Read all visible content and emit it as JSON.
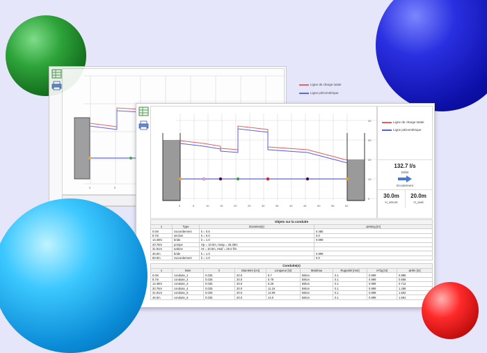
{
  "front": {
    "legend": [
      {
        "label": "Ligne de charge totale",
        "color": "#e85a5a"
      },
      {
        "label": "Ligne piézométrique",
        "color": "#5a5ae8"
      }
    ],
    "y_ticks": [
      "40",
      "30",
      "20",
      "10",
      "0"
    ],
    "x_ticks": [
      "0",
      "5",
      "10",
      "15",
      "20",
      "25",
      "30",
      "35",
      "40",
      "45",
      "50",
      "55",
      "60"
    ],
    "stats": {
      "flow_value": "132.7 l/s",
      "flow_label": "Débit",
      "flow_direction_label": "Ecoulement",
      "h_amont_value": "30.0m",
      "h_amont_label": "H_amont",
      "h_aval_value": "20.0m",
      "h_aval_label": "H_aval"
    },
    "objects_table": {
      "title": "Objets sur la conduite",
      "headers": [
        "x",
        "Type",
        "Données(s)",
        "ΔHsing [m]"
      ],
      "rows": [
        [
          "0.0m",
          "raccordement",
          "k = 0.5",
          "0.485"
        ],
        [
          "8.7m",
          "section",
          "k = 0.0",
          "0.0"
        ],
        [
          "14.49m",
          "bride",
          "k = 1.0",
          "0.999"
        ],
        [
          "20.75m",
          "pompe",
          "Hp = 10.0m, Hasp = 25.28m",
          ""
        ],
        [
          "31.91m",
          "turbine",
          "Ht = 10.0m, Hsaf = 25.0 f/m",
          ""
        ],
        [
          "46.0m",
          "bride",
          "k = 1.0",
          "0.999"
        ],
        [
          "60.0m",
          "raccordement",
          "k = 1.0",
          "0.0"
        ]
      ]
    },
    "conduits_table": {
      "title": "Conduite(s)",
      "headers": [
        "x",
        "Nom",
        "λ",
        "Diamètre [cm]",
        "Longueur [m]",
        "Matériau",
        "Rugosité [mm]",
        "v²/2g [m]",
        "ΔHlin [m]"
      ],
      "rows": [
        [
          "0.0m",
          "conduite_1",
          "0.025",
          "20.0",
          "8.7",
          "Béton",
          "0.1",
          "0.999",
          "0.985"
        ],
        [
          "8.7m",
          "conduite_2",
          "0.025",
          "20.0",
          "5.79",
          "Béton",
          "0.1",
          "0.999",
          "0.658"
        ],
        [
          "14.49m",
          "conduite_3",
          "0.025",
          "20.0",
          "6.26",
          "Béton",
          "0.1",
          "0.999",
          "0.712"
        ],
        [
          "20.75m",
          "conduite_4",
          "0.025",
          "20.0",
          "11.16",
          "Béton",
          "0.1",
          "0.999",
          "1.268"
        ],
        [
          "31.91m",
          "conduite_5",
          "0.025",
          "20.0",
          "14.09",
          "Béton",
          "0.1",
          "0.999",
          "1.602"
        ],
        [
          "46.0m",
          "conduite_6",
          "0.025",
          "20.0",
          "14.0",
          "Béton",
          "0.1",
          "0.999",
          "1.591"
        ]
      ]
    }
  },
  "back": {
    "legend": [
      {
        "label": "Ligne de charge totale",
        "color": "#e85a5a"
      },
      {
        "label": "Ligne piézométrique",
        "color": "#5a5ae8"
      }
    ],
    "x_ticks": [
      "0",
      "5",
      "10",
      "15",
      "20",
      "25"
    ]
  },
  "colors": {
    "reservoir": "#9a9a9a",
    "pipe": "#3a3acc",
    "charge_line": "#e85a5a",
    "piezo_line": "#5a5ae8"
  },
  "icons": {
    "export": "spreadsheet-icon",
    "print": "printer-icon"
  }
}
